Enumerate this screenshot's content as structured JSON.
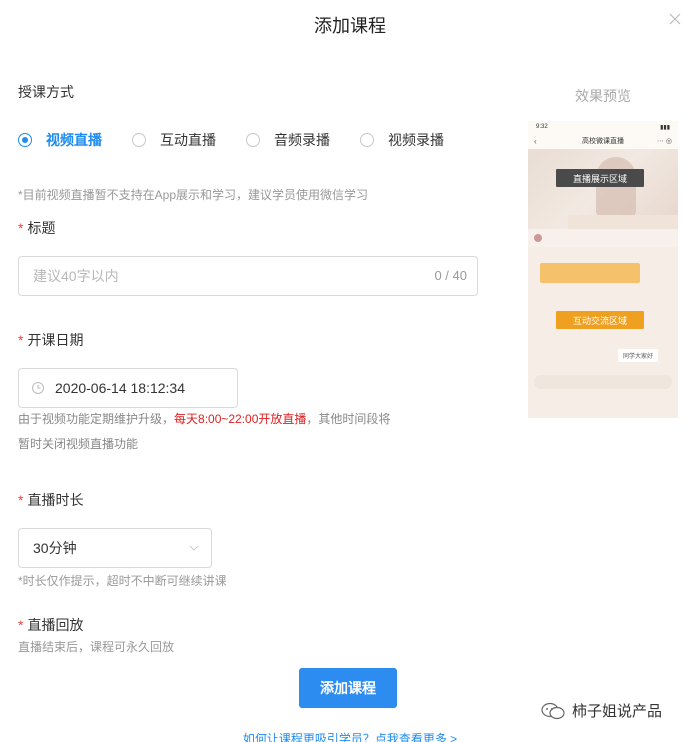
{
  "dialog": {
    "title": "添加课程"
  },
  "teaching_mode": {
    "label": "授课方式",
    "options": [
      "视频直播",
      "互动直播",
      "音频录播",
      "视频录播"
    ],
    "selected_index": 0,
    "hint": "*目前视频直播暂不支持在App展示和学习，建议学员使用微信学习"
  },
  "title_field": {
    "required_mark": "*",
    "label": "标题",
    "placeholder": "建议40字以内",
    "value": "",
    "counter": "0 / 40"
  },
  "start_date": {
    "required_mark": "*",
    "label": "开课日期",
    "value": "2020-06-14 18:12:34",
    "note_part1": "由于视频功能定期维护升级，",
    "note_highlight": "每天8:00~22:00开放直播",
    "note_part2": "，其他时间段将",
    "note_line2": "暂时关闭视频直播功能"
  },
  "duration": {
    "required_mark": "*",
    "label": "直播时长",
    "value": "30分钟",
    "hint": "*时长仅作提示，超时不中断可继续讲课"
  },
  "replay": {
    "required_mark": "*",
    "label": "直播回放",
    "hint": "直播结束后，课程可永久回放"
  },
  "actions": {
    "submit": "添加课程",
    "help_link": "如何让课程更吸引学员？点我查看更多 >"
  },
  "preview": {
    "title": "效果预览",
    "phone_time": "9:32",
    "phone_header": "高校微课直播",
    "video_area_label": "直播展示区域",
    "interaction_area_label": "互动交流区域",
    "reply_text": "同学大家好"
  },
  "watermark": {
    "text": "柿子姐说产品"
  },
  "colors": {
    "accent": "#1e8cf0",
    "required": "#e64340",
    "highlight": "#e02020",
    "button": "#2d8cf0"
  }
}
